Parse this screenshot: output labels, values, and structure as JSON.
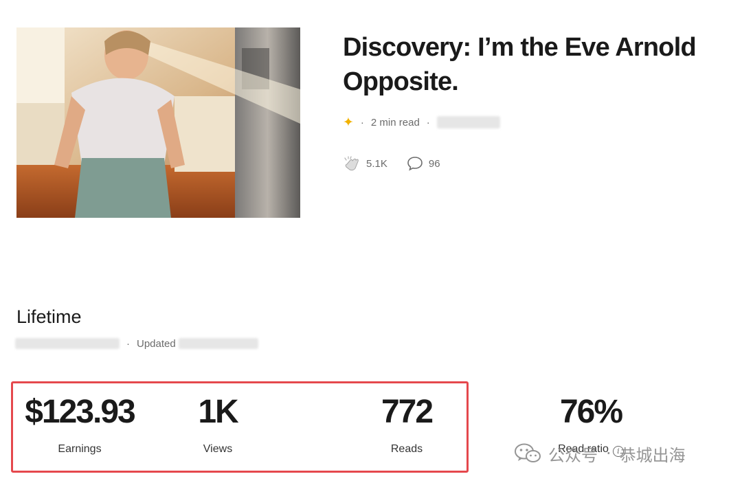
{
  "article": {
    "title": "Discovery: I’m the Eve Arnold Opposite.",
    "read_time": "2 min read",
    "claps": "5.1K",
    "responses": "96"
  },
  "lifetime": {
    "title": "Lifetime",
    "updated_label": "Updated"
  },
  "metrics": {
    "earnings_value": "$123.93",
    "earnings_label": "Earnings",
    "views_value": "1K",
    "views_label": "Views",
    "reads_value": "772",
    "reads_label": "Reads",
    "ratio_value": "76%",
    "ratio_label": "Read ratio"
  },
  "watermark": {
    "account_type": "公众号",
    "account_name": "恭城出海"
  },
  "colors": {
    "highlight": "#e5484d",
    "star": "#f2b200",
    "text": "#1a1a1a",
    "muted": "#6b6b6b"
  },
  "icons": [
    "star-icon",
    "clap-icon",
    "comment-icon",
    "info-icon",
    "wechat-icon"
  ]
}
